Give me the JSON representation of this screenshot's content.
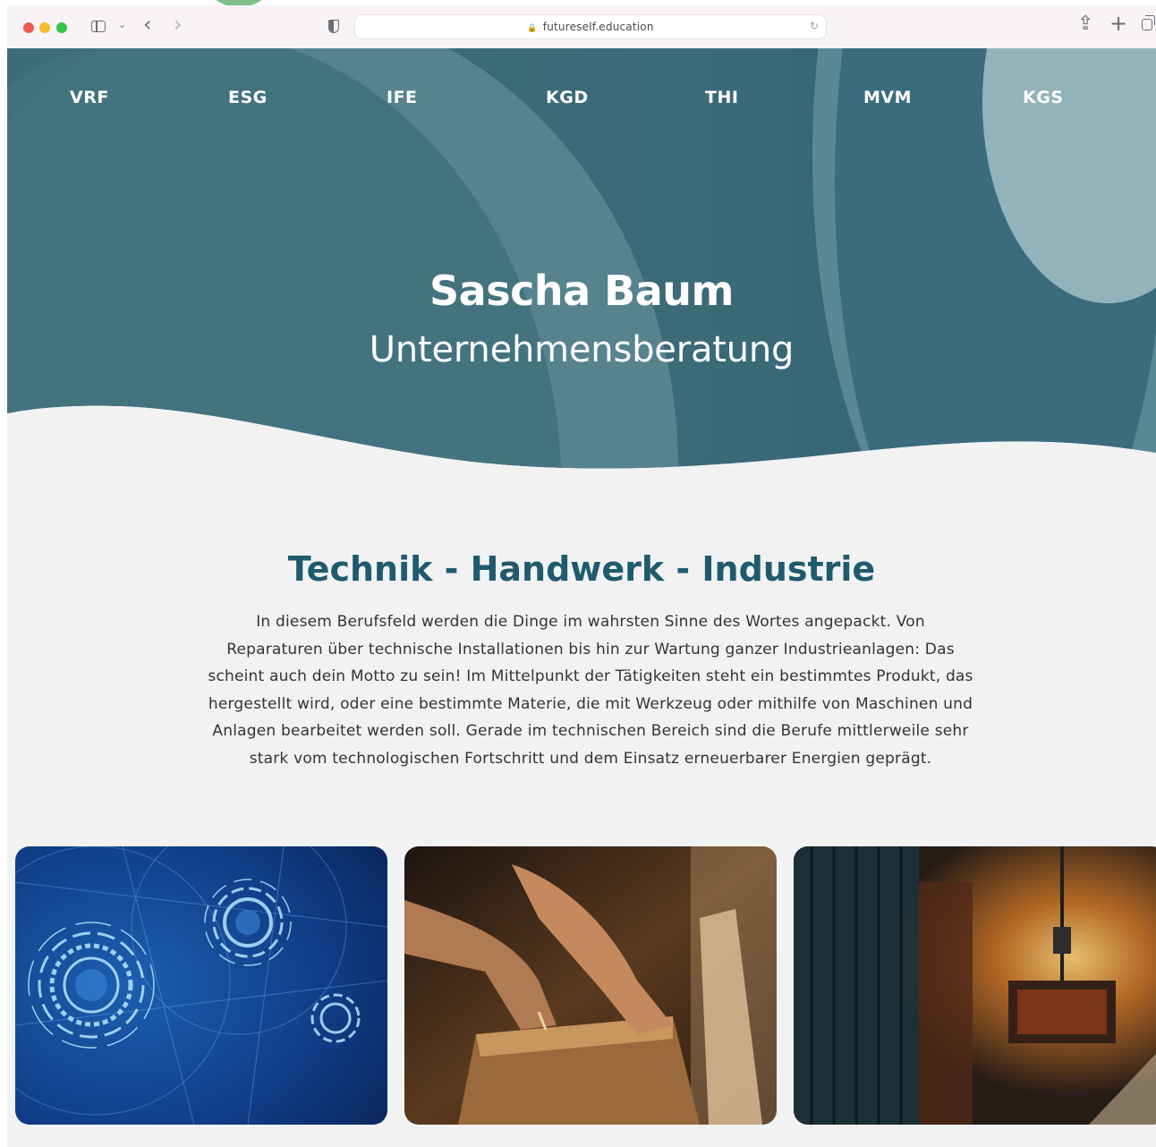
{
  "browser": {
    "url": "futureself.education"
  },
  "nav": {
    "items": [
      "VRF",
      "ESG",
      "IFE",
      "KGD",
      "THI",
      "MVM",
      "KGS"
    ]
  },
  "hero": {
    "title": "Sascha Baum",
    "subtitle": "Unternehmensberatung"
  },
  "section": {
    "title": "Technik - Handwerk - Industrie",
    "body": "In diesem Berufsfeld werden die Dinge im wahrsten Sinne des Wortes angepackt. Von Reparaturen über technische Installationen bis hin zur Wartung ganzer Industrieanlagen: Das scheint auch dein Motto zu sein! Im Mittelpunkt der Tätigkeiten steht ein bestimmtes Produkt, das hergestellt wird, oder eine bestimmte Materie, die mit Werkzeug oder mithilfe von Maschinen und Anlagen bearbeitet werden soll. Gerade im technischen Bereich sind die Berufe mittlerweile sehr stark vom technologischen Fortschritt und dem Einsatz erneuerbarer Energien geprägt."
  },
  "icons": {
    "toolbar": [
      "sidebar-icon",
      "chevron-down-icon",
      "back-icon",
      "forward-icon",
      "shield-icon",
      "lock-icon",
      "reload-icon",
      "share-icon",
      "plus-icon",
      "tabs-icon"
    ]
  },
  "colors": {
    "hero": "#3d6f7d",
    "accent": "#1f5a6e",
    "background": "#f2f2f2"
  }
}
